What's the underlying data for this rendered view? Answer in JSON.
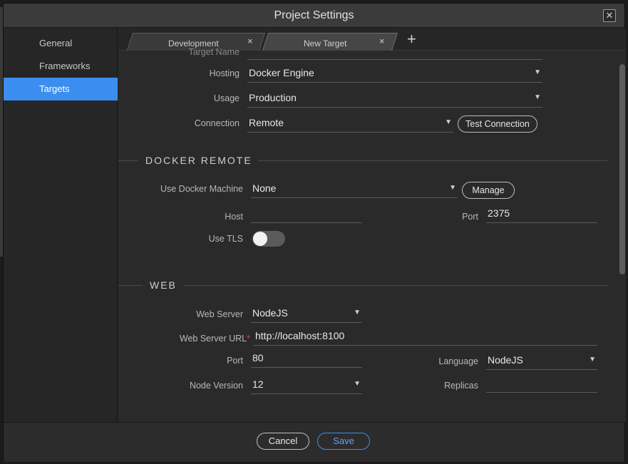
{
  "dialog": {
    "title": "Project Settings",
    "close_glyph": "✕"
  },
  "sidebar": {
    "items": [
      {
        "label": "General"
      },
      {
        "label": "Frameworks"
      },
      {
        "label": "Targets"
      }
    ]
  },
  "tabs": [
    {
      "label": "Development",
      "close_glyph": "×"
    },
    {
      "label": "New Target",
      "close_glyph": "×"
    }
  ],
  "add_tab_glyph": "+",
  "target": {
    "target_name_label": "Target Name",
    "hosting_label": "Hosting",
    "hosting_value": "Docker Engine",
    "usage_label": "Usage",
    "usage_value": "Production",
    "connection_label": "Connection",
    "connection_value": "Remote",
    "test_connection_label": "Test Connection"
  },
  "docker_remote": {
    "section_title": "DOCKER REMOTE",
    "docker_machine_label": "Use Docker Machine",
    "docker_machine_value": "None",
    "manage_label": "Manage",
    "host_label": "Host",
    "host_value": "",
    "port_label": "Port",
    "port_value": "2375",
    "use_tls_label": "Use TLS",
    "use_tls_enabled": false
  },
  "web": {
    "section_title": "WEB",
    "web_server_label": "Web Server",
    "web_server_value": "NodeJS",
    "web_server_url_label": "Web Server URL",
    "required_mark": "*",
    "web_server_url_value": "http://localhost:8100",
    "port_label": "Port",
    "port_value": "80",
    "language_label": "Language",
    "language_value": "NodeJS",
    "node_version_label": "Node Version",
    "node_version_value": "12",
    "replicas_label": "Replicas",
    "replicas_value": ""
  },
  "footer": {
    "cancel_label": "Cancel",
    "save_label": "Save"
  },
  "icons": {
    "caret": "▼"
  },
  "colors": {
    "accent": "#3b8ef0",
    "background": "#2a2a2a"
  }
}
